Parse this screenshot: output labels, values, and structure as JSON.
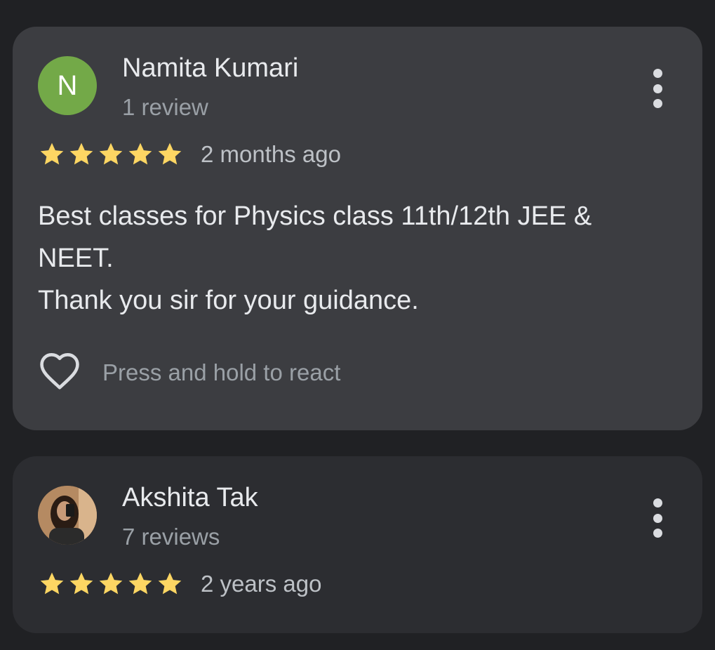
{
  "reviews": [
    {
      "avatar_letter": "N",
      "avatar_color": "#73a948",
      "name": "Namita Kumari",
      "review_count": "1 review",
      "rating": 5,
      "time": "2 months ago",
      "text_lines": [
        "Best classes for Physics class 11th/12th JEE &",
        "NEET.",
        "Thank you sir for your guidance."
      ],
      "react_label": "Press and hold to react"
    },
    {
      "avatar_letter": "",
      "name": "Akshita Tak",
      "review_count": "7 reviews",
      "rating": 5,
      "time": "2 years ago"
    }
  ],
  "colors": {
    "background": "#202124",
    "card_highlight": "#3c3d41",
    "card_normal": "#2c2d31",
    "star": "#fdd663",
    "primary_text": "#e8eaed",
    "secondary_text": "#9aa0a6"
  },
  "icons": {
    "star": "star-icon",
    "more": "more-vert-icon",
    "react": "heart-outline-icon"
  }
}
